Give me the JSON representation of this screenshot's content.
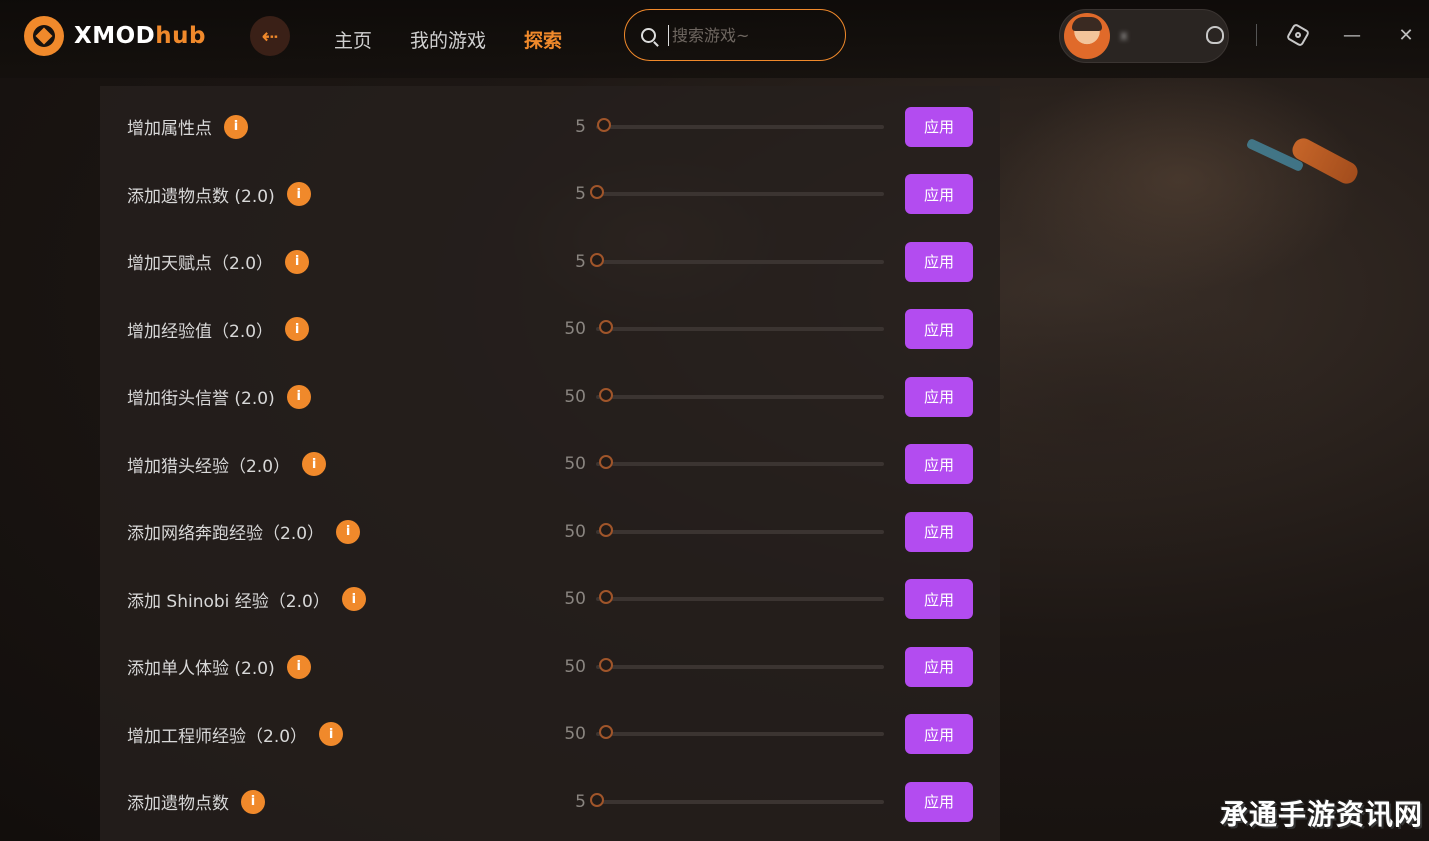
{
  "app": {
    "logo_main": "XMOD",
    "logo_accent": "hub"
  },
  "nav": {
    "items": [
      "主页",
      "我的游戏",
      "探索"
    ],
    "active_index": 2
  },
  "search": {
    "placeholder": "搜索游戏~"
  },
  "user": {
    "name_blurred": "x"
  },
  "mods": [
    {
      "label": "增加属性点",
      "value": "5"
    },
    {
      "label": "添加遗物点数 (2.0)",
      "value": "5"
    },
    {
      "label": "增加天赋点（2.0）",
      "value": "5"
    },
    {
      "label": "增加经验值（2.0）",
      "value": "50"
    },
    {
      "label": "增加街头信誉 (2.0)",
      "value": "50"
    },
    {
      "label": "增加猎头经验（2.0）",
      "value": "50"
    },
    {
      "label": "添加网络奔跑经验（2.0）",
      "value": "50"
    },
    {
      "label": "添加 Shinobi 经验（2.0）",
      "value": "50"
    },
    {
      "label": "添加单人体验 (2.0)",
      "value": "50"
    },
    {
      "label": "增加工程师经验（2.0）",
      "value": "50"
    },
    {
      "label": "添加遗物点数",
      "value": "5"
    }
  ],
  "apply_label": "应用",
  "watermark": "承通手游资讯网",
  "colors": {
    "accent": "#f0892b",
    "apply_button": "#b34cf0",
    "panel": "#26201d"
  },
  "icons": {
    "back": "arrow-left-icon",
    "search": "search-icon",
    "bell": "bell-icon",
    "settings": "settings-icon",
    "minimize": "minimize-icon",
    "close": "close-icon",
    "info": "info-icon"
  }
}
